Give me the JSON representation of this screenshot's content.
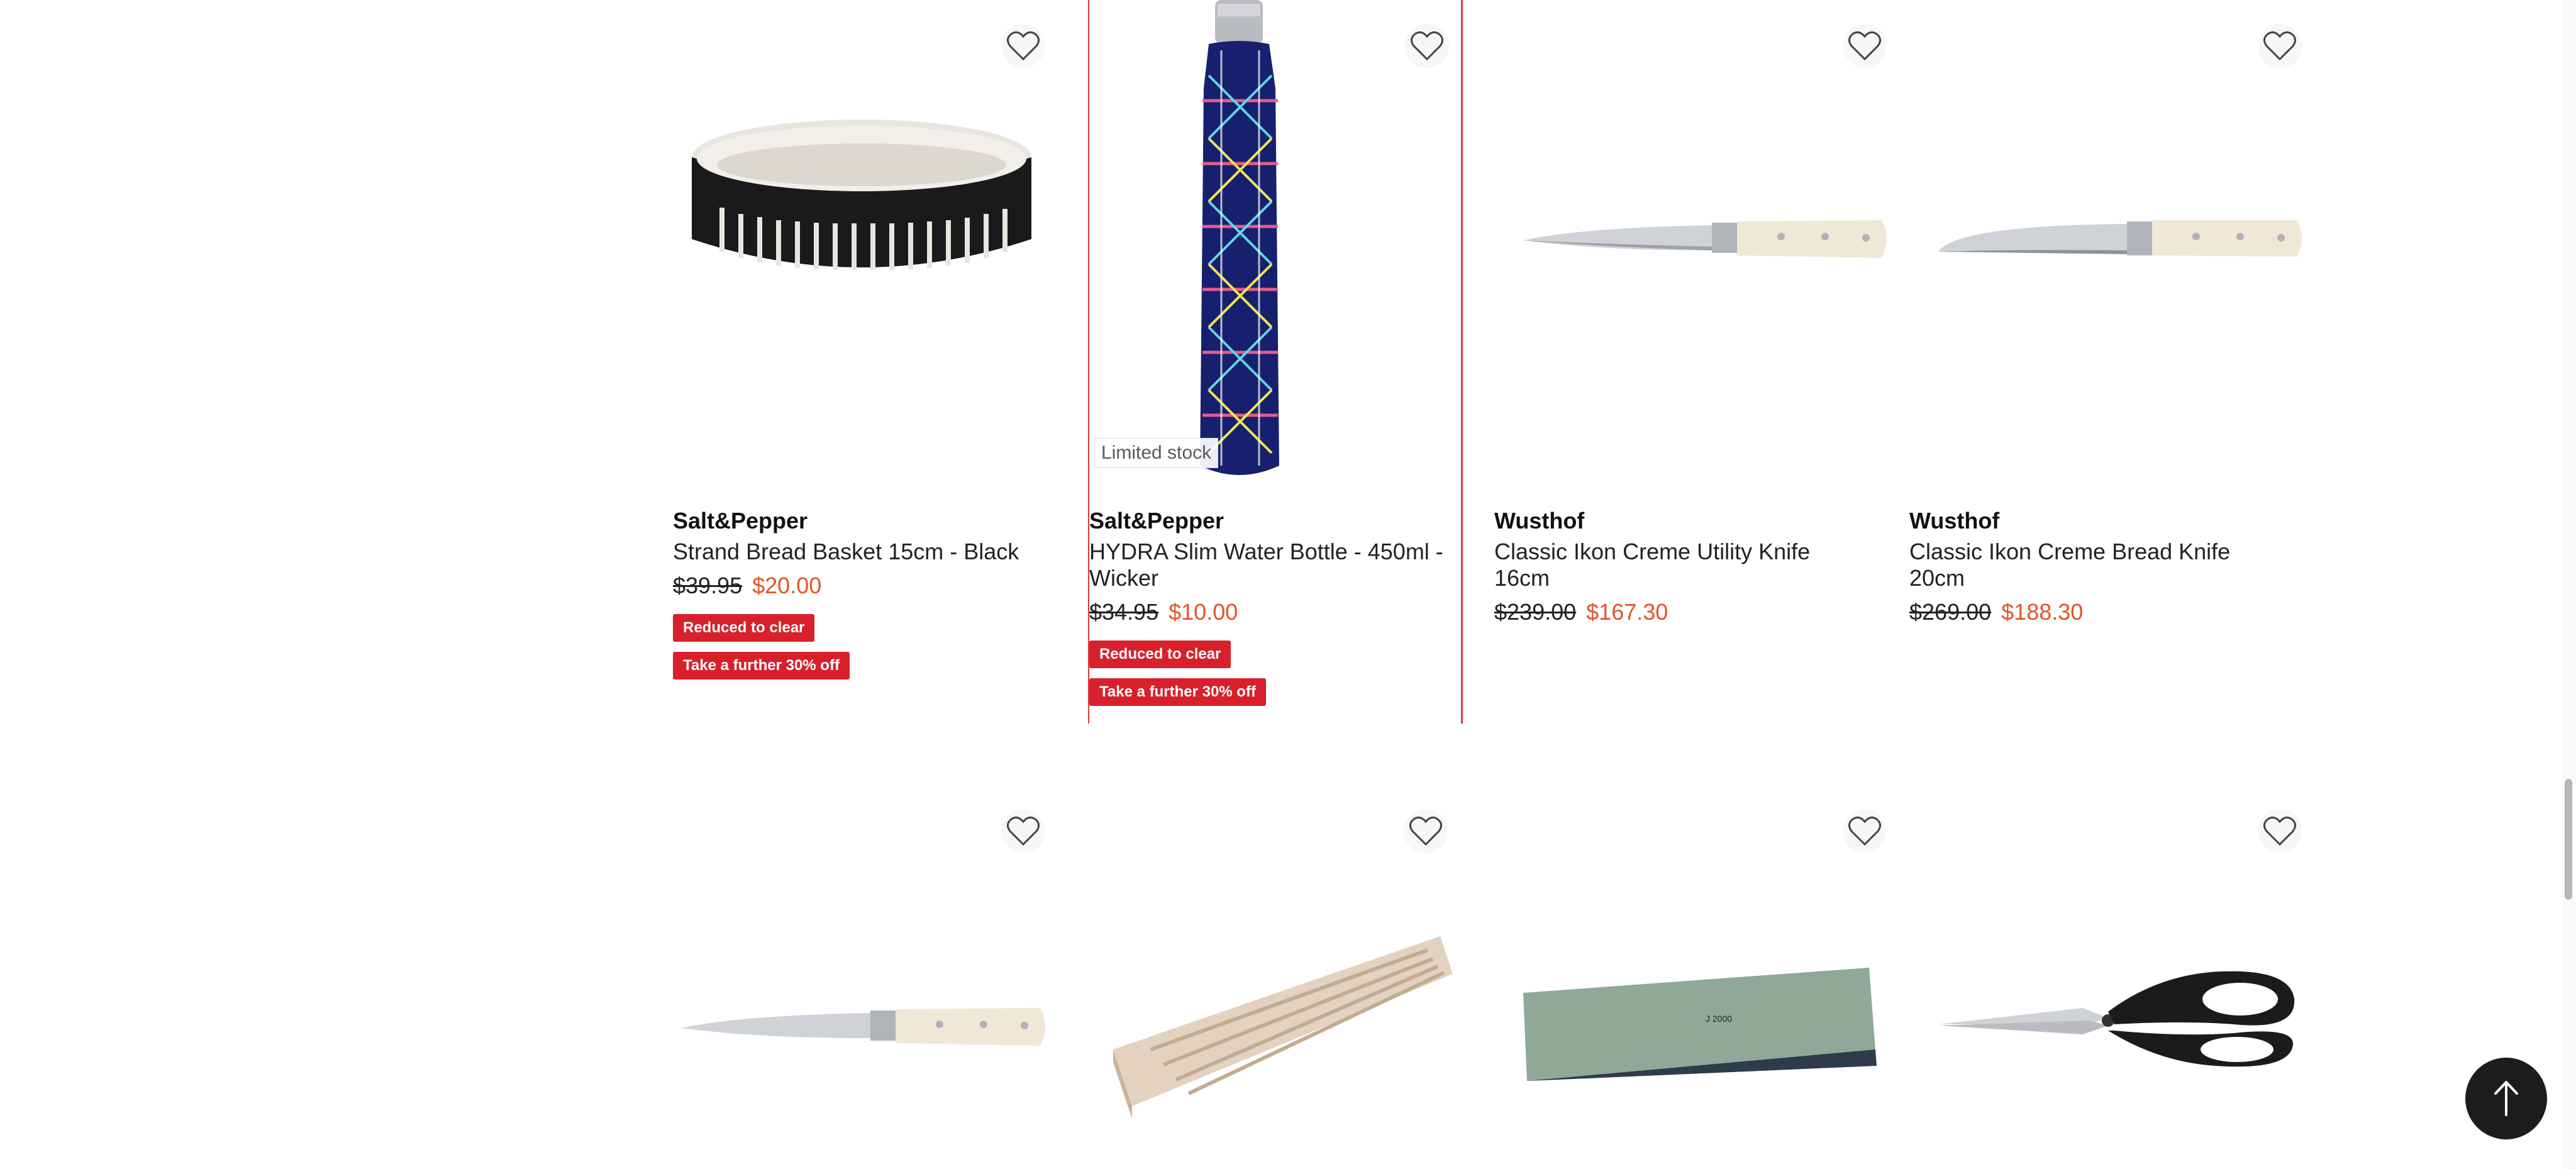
{
  "products_row1": [
    {
      "brand": "Salt&Pepper",
      "title": "Strand Bread Basket 15cm - Black",
      "was_price": "$39.95",
      "now_price": "$20.00",
      "badges": [
        "Reduced to clear",
        "Take a further 30% off"
      ],
      "image_icon": "bread-basket-icon"
    },
    {
      "brand": "Salt&Pepper",
      "title": "HYDRA Slim Water Bottle - 450ml - Wicker",
      "was_price": "$34.95",
      "now_price": "$10.00",
      "limited_label": "Limited stock",
      "badges": [
        "Reduced to clear",
        "Take a further 30% off"
      ],
      "image_icon": "water-bottle-icon"
    },
    {
      "brand": "Wusthof",
      "title": "Classic Ikon Creme Utility Knife 16cm",
      "was_price": "$239.00",
      "now_price": "$167.30",
      "image_icon": "utility-knife-icon"
    },
    {
      "brand": "Wusthof",
      "title": "Classic Ikon Creme Bread Knife 20cm",
      "was_price": "$269.00",
      "now_price": "$188.30",
      "image_icon": "bread-knife-icon"
    }
  ],
  "products_row2": [
    {
      "image_icon": "knife-icon"
    },
    {
      "image_icon": "knife-block-tray-icon"
    },
    {
      "image_icon": "sharpening-stone-icon",
      "stone_label": "J 2000"
    },
    {
      "image_icon": "kitchen-shears-icon"
    }
  ],
  "colors": {
    "accent": "#d8202c",
    "sale_price": "#e0552a",
    "highlight_border": "#e03a3a"
  }
}
